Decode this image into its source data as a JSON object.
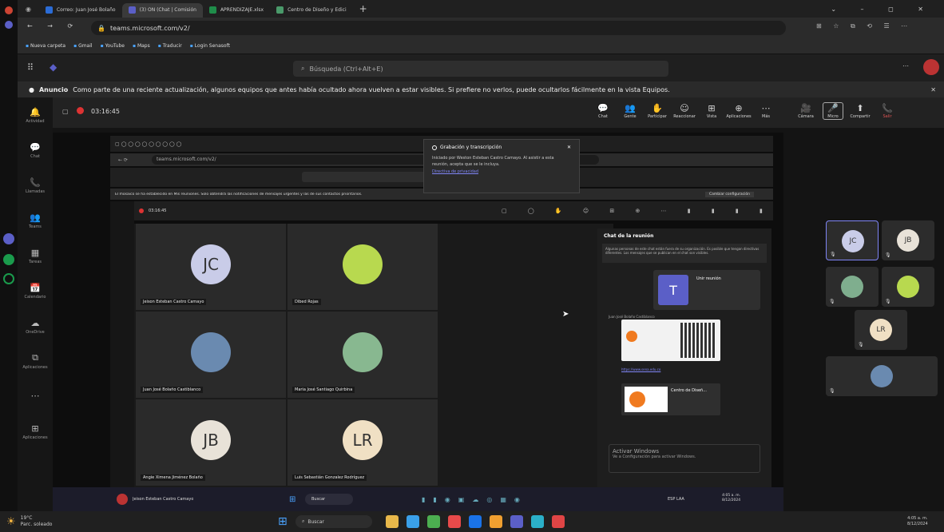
{
  "browser": {
    "tabs": [
      {
        "label": "Correo: Juan José Bolaño",
        "color": "#2b6cd6"
      },
      {
        "label": "(3) ON (Chat | Comisión",
        "color": "#5b5fc7",
        "active": true
      },
      {
        "label": "APRENDIZAJE.xlsx",
        "color": "#1f8d4a"
      },
      {
        "label": "Centro de Diseño y Edici",
        "color": "#4a9a6a"
      }
    ],
    "url": "teams.microsoft.com/v2/",
    "bookmarks": [
      "Nueva carpeta",
      "Gmail",
      "YouTube",
      "Maps",
      "Traducir",
      "Login Senasoft"
    ]
  },
  "teams": {
    "search_placeholder": "Búsqueda (Ctrl+Alt+E)",
    "banner_bold": "Anuncio",
    "banner_text": "Como parte de una reciente actualización, algunos equipos que antes había ocultado ahora vuelven a estar visibles. Si prefiere no verlos, puede ocultarlos fácilmente en la vista Equipos.",
    "rail": [
      {
        "icon": "🔔",
        "label": "Actividad"
      },
      {
        "icon": "💬",
        "label": "Chat"
      },
      {
        "icon": "📞",
        "label": "Llamadas"
      },
      {
        "icon": "👥",
        "label": "Teams"
      },
      {
        "icon": "▦",
        "label": "Tareas"
      },
      {
        "icon": "📅",
        "label": "Calendario"
      },
      {
        "icon": "☁",
        "label": "OneDrive"
      },
      {
        "icon": "⧉",
        "label": "Aplicaciones"
      },
      {
        "icon": "⋯",
        "label": ""
      },
      {
        "icon": "⊞",
        "label": "Aplicaciones"
      }
    ],
    "meeting_timer": "03:16:45",
    "toolbar": [
      {
        "icon": "💬",
        "label": "Chat"
      },
      {
        "icon": "👥",
        "label": "Gente"
      },
      {
        "icon": "✋",
        "label": "Participar"
      },
      {
        "icon": "☺",
        "label": "Reaccionar"
      },
      {
        "icon": "⊞",
        "label": "Vista"
      },
      {
        "icon": "⊕",
        "label": "Aplicaciones"
      },
      {
        "icon": "⋯",
        "label": "Más"
      },
      {
        "icon": "🎥",
        "label": "Cámara"
      },
      {
        "icon": "🎤",
        "label": "Micro"
      },
      {
        "icon": "⬆",
        "label": "Compartir"
      },
      {
        "icon": "📞",
        "label": "Salir"
      }
    ],
    "captions_popup": {
      "title": "Grabación y transcripción",
      "text": "Iniciado por Weston Esteban Castro Camayo. Al asistir a esta reunión, acepta que se le incluya.",
      "link": "Directiva de privacidad"
    },
    "inner_banner": "El mosaico se ha establecido en Mis reuniones. Solo obtendrá las notificaciones de mensajes urgentes y las de sus contactos prioritarios.",
    "inner_banner_button": "Cambiar configuración",
    "inner_timer": "03:16:45",
    "participants": [
      {
        "initials": "JC",
        "name": "Jeison Esteban Castro Camayo",
        "color": "#c9cce8"
      },
      {
        "initials": "",
        "name": "Dibed Rojas",
        "color": "#b8d94f"
      },
      {
        "initials": "",
        "name": "Juan José Bolaño Castiblanco",
        "color": "#6a8ab0"
      },
      {
        "initials": "",
        "name": "Maria José Santiago Quirbina",
        "color": "#88b890"
      },
      {
        "initials": "JB",
        "name": "Angie Ximena Jiménez Bolaño",
        "color": "#e8e2d8"
      },
      {
        "initials": "LR",
        "name": "Luis Sebastián Gonzalez Rodríguez",
        "color": "#f0e0c4"
      }
    ],
    "chat": {
      "title": "Chat de la reunión",
      "notice": "Algunas personas de este chat están fuera de su organización. Es posible que tengan directivas diferentes. Los mensajes que se publican en el chat son visibles.",
      "card_title": "Unir reunión",
      "sender": "Juan José Bolaño Castiblanco",
      "file_title": "Centro de Diseñ...",
      "activate_line1": "Activar Windows",
      "activate_line2": "Ve a Configuración para activar Windows."
    },
    "right_strip": [
      {
        "initials": "JC",
        "color": "#c9cce8"
      },
      {
        "initials": "JB",
        "color": "#e8e2d8"
      },
      {
        "initials": "",
        "color": "#7fae8e"
      },
      {
        "initials": "",
        "color": "#b8d94f"
      },
      {
        "initials": "LR",
        "color": "#f0e0c4"
      },
      {
        "initials": "",
        "color": "#6a8ab0"
      }
    ]
  },
  "inner_taskbar": {
    "user": "Jeison Esteban Castro Camayo",
    "search": "Buscar",
    "time": "4:05 a. m.",
    "date": "8/12/2024",
    "lang": "ESP LAA"
  },
  "taskbar": {
    "weather_temp": "19°C",
    "weather_text": "Parc. soleado",
    "search": "Buscar",
    "time": "4:05 a. m.",
    "date": "8/12/2024"
  }
}
